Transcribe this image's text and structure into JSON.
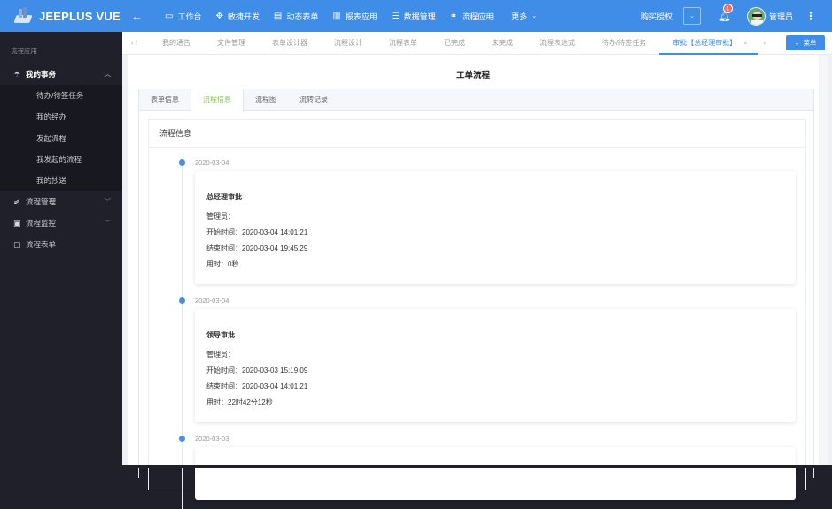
{
  "header": {
    "logo_text": "JEEPLUS VUE",
    "back_icon": "arrow-left-icon",
    "nav": [
      {
        "label": "工作台",
        "icon": "monitor-icon"
      },
      {
        "label": "敏捷开发",
        "icon": "agile-icon"
      },
      {
        "label": "动态表单",
        "icon": "form-icon"
      },
      {
        "label": "报表应用",
        "icon": "bar-chart-icon"
      },
      {
        "label": "数据管理",
        "icon": "database-icon"
      },
      {
        "label": "流程应用",
        "icon": "workflow-icon"
      },
      {
        "label": "更多",
        "icon": "chevron-down-icon"
      }
    ],
    "buy_license": "购买授权",
    "notification_count": "1",
    "user_name": "管理员",
    "brand_color": "#3f8de6"
  },
  "sidebar": {
    "group_label": "流程应用",
    "items": [
      {
        "label": "我的事务",
        "icon": "umbrella-icon",
        "expanded": true,
        "children": [
          "待办/待签任务",
          "我的经办",
          "发起流程",
          "我发起的流程",
          "我的抄送"
        ]
      },
      {
        "label": "流程管理",
        "icon": "share-icon",
        "expanded": false
      },
      {
        "label": "流程监控",
        "icon": "monitor-eye-icon",
        "expanded": false
      },
      {
        "label": "流程表单",
        "icon": "form-frame-icon",
        "expanded": false
      }
    ]
  },
  "tabbar": {
    "left_label": "‹ !",
    "tabs": [
      "我的通告",
      "文件管理",
      "表单设计器",
      "流程设计",
      "流程表单",
      "已完成",
      "未完成",
      "流程表达式",
      "待办/待签任务"
    ],
    "active_tab": "审批【总经理审批】",
    "menu_button": "菜单"
  },
  "page": {
    "title": "工单流程",
    "content_tabs": [
      "表单信息",
      "流程信息",
      "流程图",
      "流转记录"
    ],
    "active_content_tab": "流程信息",
    "section_title": "流程信息"
  },
  "timeline": [
    {
      "date": "2020-03-04",
      "title": "总经理审批",
      "assignee": "管理员：",
      "start": "开始时间：2020-03-04 14:01:21",
      "end": "结束时间：2020-03-04 19:45:29",
      "duration": "用时：0秒"
    },
    {
      "date": "2020-03-04",
      "title": "领导审批",
      "assignee": "管理员：",
      "start": "开始时间：2020-03-03 15:19:09",
      "end": "结束时间：2020-03-04 14:01:21",
      "duration": "用时：22时42分12秒"
    },
    {
      "date": "2020-03-03"
    }
  ]
}
